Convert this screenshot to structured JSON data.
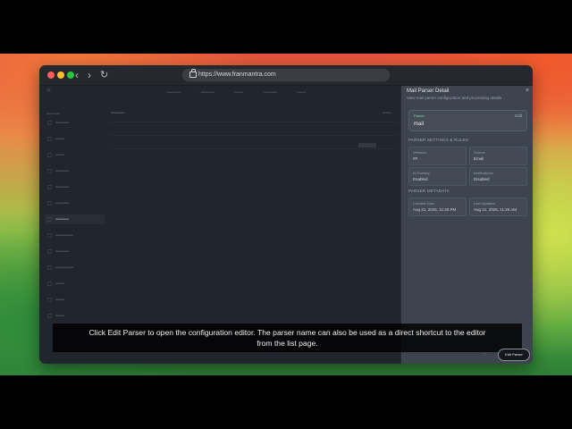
{
  "browser": {
    "url": "https://www.franmantra.com"
  },
  "panel": {
    "title": "Mail Parser Detail",
    "subtitle": "View mail parser configuration and processing details",
    "close_icon": "close-icon",
    "card": {
      "chip": "Parser",
      "name": "mail",
      "edit": "Edit"
    },
    "section1": "PARSER SETTINGS & RULES",
    "fields1": [
      {
        "key": "Versions",
        "value": "##"
      },
      {
        "key": "Source",
        "value": "Email"
      },
      {
        "key": "AI Parsing",
        "value": "Enabled"
      },
      {
        "key": "Notifications",
        "value": "Disabled"
      }
    ],
    "section2": "PARSER METADATA",
    "fields2": [
      {
        "key": "Created Date",
        "value": "Aug 21, 2025, 11:26 PM"
      },
      {
        "key": "Last Updated",
        "value": "Aug 21, 2025, 11:26 AM"
      }
    ]
  },
  "caption": {
    "line1": "Click Edit Parser to open the configuration editor. The parser name can also be used as a direct shortcut to the editor",
    "line2": "from the list page."
  },
  "floating_button": {
    "label": "Edit Parser"
  }
}
